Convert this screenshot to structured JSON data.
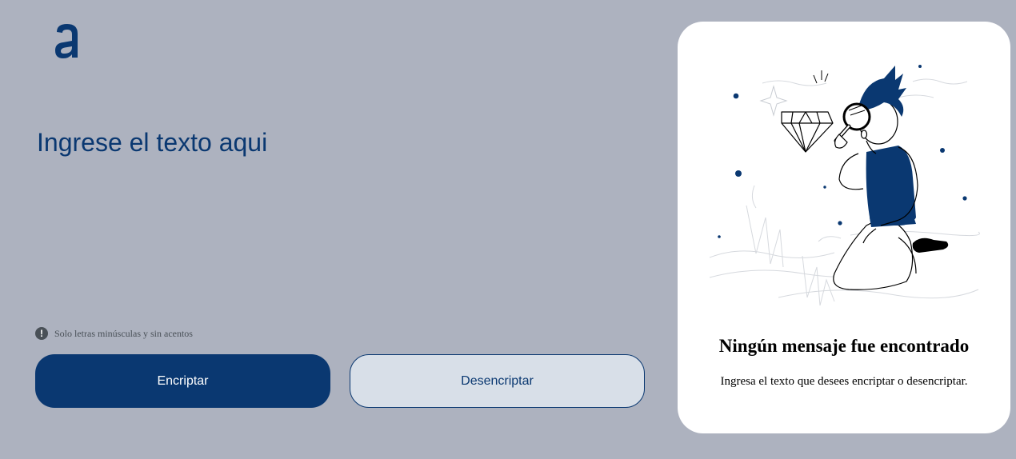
{
  "logo": {
    "icon": "alura-logo-icon",
    "color": "#0a3871"
  },
  "input": {
    "placeholder": "Ingrese el texto aqui",
    "value": ""
  },
  "hint": {
    "icon": "exclamation-circle-icon",
    "text": "Solo letras minúsculas y sin acentos"
  },
  "buttons": {
    "encrypt_label": "Encriptar",
    "decrypt_label": "Desencriptar"
  },
  "output_panel": {
    "illustration": "person-with-magnifying-glass-and-diamond",
    "title": "Ningún mensaje fue encontrado",
    "message": "Ingresa el texto que desees encriptar o desencriptar."
  },
  "colors": {
    "background": "#adb2bf",
    "primary": "#0a3871",
    "secondary_button": "#d8dfe8",
    "panel": "#ffffff"
  }
}
